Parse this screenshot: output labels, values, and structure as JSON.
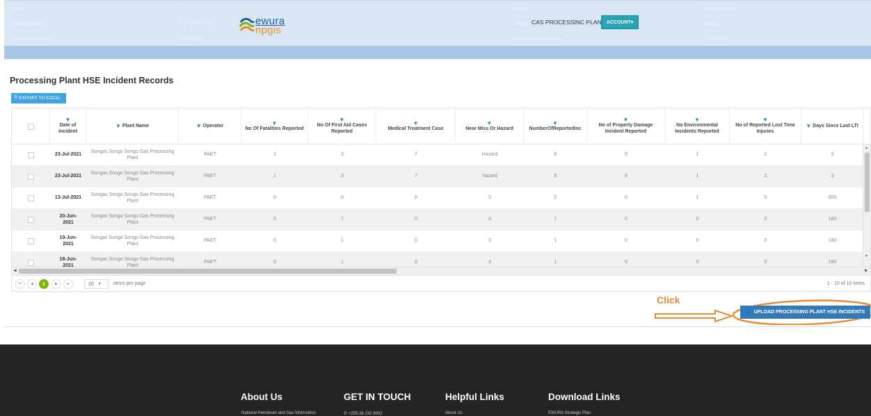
{
  "info": {
    "block_label": "Block:",
    "block_value": "9",
    "postal_label": "Postal Address:",
    "postal_value": "P. O. BOX 4041",
    "commenced_label": "Commenced Date:",
    "commenced_value": "2020-03-15",
    "village_label": "Village:",
    "village_value": "Songo Songo",
    "status_label": "Status:",
    "status_value": "Active",
    "prod_label": "Production Start Date:",
    "prod_value": "2020-03-15"
  },
  "logo": {
    "top": "ewura",
    "bottom": "npgis"
  },
  "header": {
    "title": "CAS PROCESSINC PLANTS",
    "account_label": "ACCOUNT▾"
  },
  "section_title": "Processing Plant HSE Incident Records",
  "export_label": "EXPORT TO EXCEL",
  "columns": [
    "Date of Incident",
    "Plant Name",
    "Operator",
    "No Of Fatalities Reported",
    "No Of First Aid Cases Reported",
    "Medical Treatment Case",
    "Near Miss Or Hazard",
    "NumberOfReportedInc",
    "No of Property Damage Incident Reported",
    "No Environmental Incidents Reported",
    "No of Reported Lost Time Injuries",
    "Days Since Last LTI"
  ],
  "rows": [
    [
      "23-Jul-2021",
      "Songas Songo Songo Gas Processing Plant",
      "PAET",
      "1",
      "3",
      "7",
      "Hazard",
      "8",
      "9",
      "1",
      "2",
      "3"
    ],
    [
      "23-Jul-2021",
      "Songas Songo Songo Gas Processing Plant",
      "PAET",
      "1",
      "3",
      "7",
      "hazard",
      "8",
      "9",
      "1",
      "2",
      "3"
    ],
    [
      "13-Jul-2021",
      "Songas Songo Songo Gas Processing Plant",
      "PAET",
      "0",
      "0",
      "0",
      "5",
      "5",
      "0",
      "1",
      "0",
      "300"
    ],
    [
      "20-Jun-2021",
      "Songas Songo Songo Gas Processing Plant",
      "PAET",
      "0",
      "1",
      "0",
      "3",
      "1",
      "0",
      "0",
      "0",
      "180"
    ],
    [
      "19-Jun-2021",
      "Songas Songo Songo Gas Processing Plant",
      "PAET",
      "0",
      "1",
      "0",
      "3",
      "1",
      "0",
      "0",
      "0",
      "180"
    ],
    [
      "18-Jun-2021",
      "Songas Songo Songo Gas Processing Plant",
      "PAET",
      "0",
      "1",
      "0",
      "3",
      "1",
      "0",
      "0",
      "0",
      "180"
    ]
  ],
  "pager": {
    "current_page": "1",
    "page_size": "20",
    "items_per_page_label": "items per page",
    "info": "1 - 10 of 10 items"
  },
  "annotation": {
    "click_label": "Click"
  },
  "upload_label": "UPLOAD PROCESSING PLANT HSE INCIDENTS",
  "footer": {
    "about_heading": "About Us",
    "about_item": "National Petroleum and Gas Information",
    "contact_heading": "GET IN TOUCH",
    "contact_item": "+255-26 232 9002",
    "helpful_heading": "Helpful Links",
    "helpful_item": "About Us",
    "download_heading": "Download Links",
    "download_item": "EWURA Strategic Plan"
  },
  "colors": {
    "accent_teal": "#2aa3b5",
    "export_blue": "#3fa4dd",
    "upload_blue": "#337ab7",
    "pager_green": "#7ab800",
    "annotation_orange": "#e88a33",
    "footer_bg": "#232323"
  }
}
